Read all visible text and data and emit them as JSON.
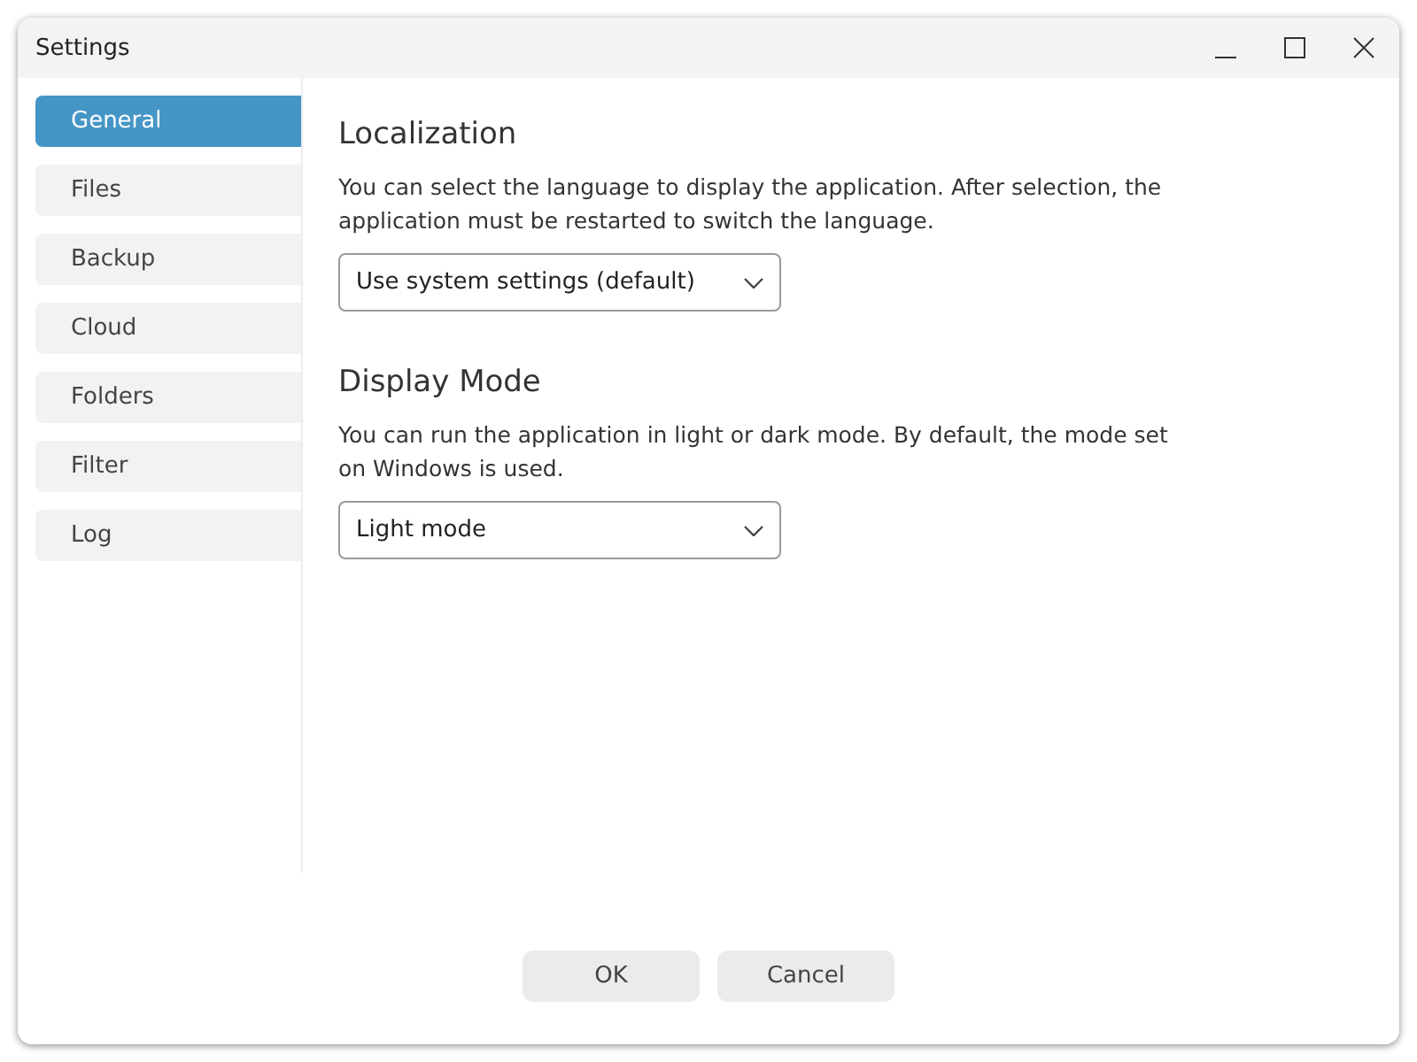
{
  "window": {
    "title": "Settings"
  },
  "sidebar": {
    "items": [
      {
        "label": "General",
        "selected": true
      },
      {
        "label": "Files",
        "selected": false
      },
      {
        "label": "Backup",
        "selected": false
      },
      {
        "label": "Cloud",
        "selected": false
      },
      {
        "label": "Folders",
        "selected": false
      },
      {
        "label": "Filter",
        "selected": false
      },
      {
        "label": "Log",
        "selected": false
      }
    ]
  },
  "sections": [
    {
      "heading": "Localization",
      "description": "You can select the language to display the application. After selection, the application must be restarted to switch the language.",
      "dropdown": {
        "value": "Use system settings (default)"
      }
    },
    {
      "heading": "Display Mode",
      "description": "You can run the application in light or dark mode. By default, the mode set on Windows is used.",
      "dropdown": {
        "value": "Light mode"
      }
    }
  ],
  "buttons": [
    "OK",
    "Cancel"
  ]
}
